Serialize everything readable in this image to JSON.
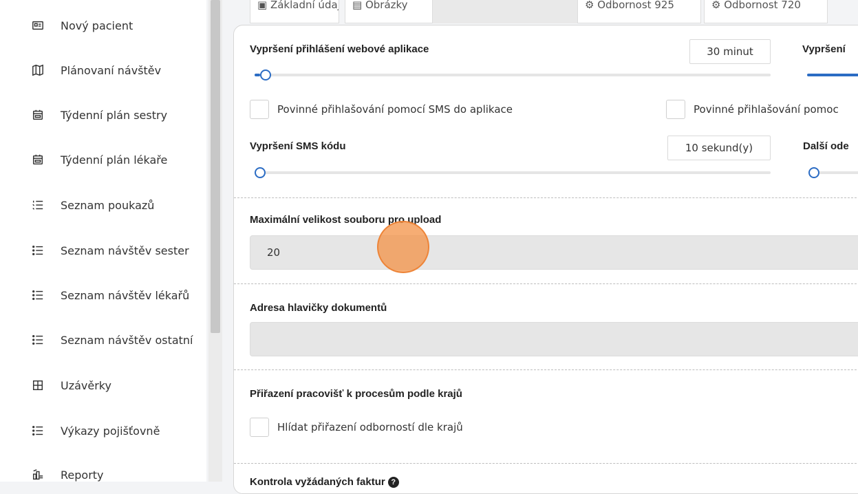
{
  "sidebar": {
    "items": [
      {
        "label": "Nový pacient",
        "icon": "id-card-icon"
      },
      {
        "label": "Plánovaní návštěv",
        "icon": "map-icon"
      },
      {
        "label": "Týdenní plán sestry",
        "icon": "calendar-icon"
      },
      {
        "label": "Týdenní plán lékaře",
        "icon": "calendar-icon"
      },
      {
        "label": "Seznam poukazů",
        "icon": "ordered-list-icon"
      },
      {
        "label": "Seznam návštěv sester",
        "icon": "list-icon"
      },
      {
        "label": "Seznam návštěv lékařů",
        "icon": "list-icon"
      },
      {
        "label": "Seznam návštěv ostatní",
        "icon": "list-icon"
      },
      {
        "label": "Uzávěrky",
        "icon": "table-icon"
      },
      {
        "label": "Výkazy pojišťovně",
        "icon": "list-icon"
      },
      {
        "label": "Reporty",
        "icon": "report-icon"
      }
    ]
  },
  "tabs": [
    {
      "label": "Základní údaje"
    },
    {
      "label": "Obrázky"
    },
    {
      "label": "Odbornost 925"
    },
    {
      "label": "Odbornost 720"
    }
  ],
  "settings": {
    "web_timeout": {
      "label": "Vypršení přihlášení webové aplikace",
      "value": "30 minut",
      "slider_fraction": 0.0
    },
    "right_timeout": {
      "label": "Vypršení"
    },
    "sms_login_checkbox": {
      "label": "Povinné přihlašování pomocí SMS do aplikace",
      "checked": false
    },
    "sms_login_checkbox_right": {
      "label": "Povinné přihlašování pomoc",
      "checked": false
    },
    "sms_code_timeout": {
      "label": "Vypršení SMS kódu",
      "value": "10 sekund(y)",
      "slider_fraction": 0.0
    },
    "next_send": {
      "label": "Další ode"
    },
    "max_upload": {
      "label": "Maximální velikost souboru pro upload",
      "value": "20"
    },
    "doc_header": {
      "label": "Adresa hlavičky dokumentů",
      "value": ""
    },
    "region_assign": {
      "label": "Přiřazení pracovišť k procesům podle krajů"
    },
    "watch_assign_checkbox": {
      "label": "Hlídat přiřazení odborností dle krajů",
      "checked": false
    },
    "bottom_label": {
      "label": "Kontrola vyžádaných faktur"
    }
  },
  "colors": {
    "accent": "#2b6cc4",
    "cursor": "#f39246"
  }
}
